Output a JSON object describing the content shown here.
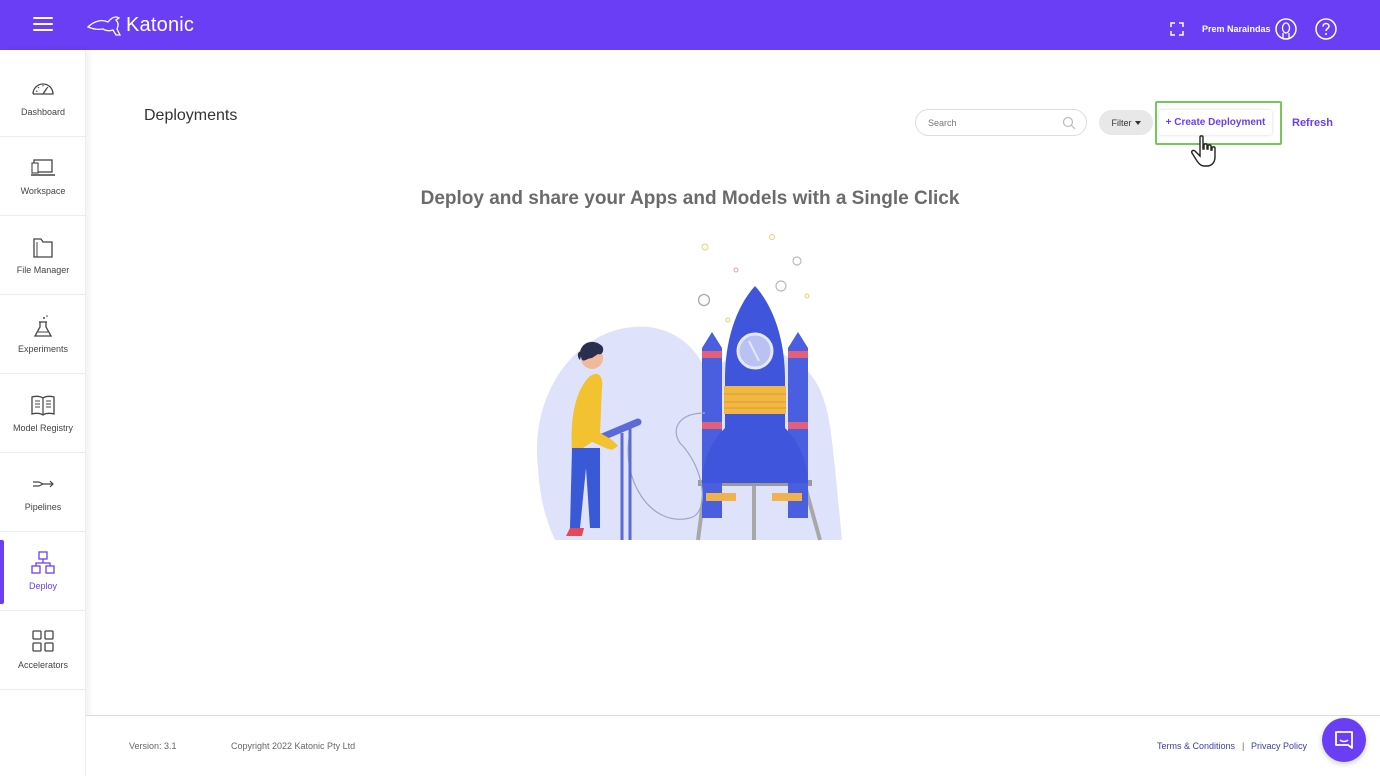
{
  "app": {
    "name": "Katonic"
  },
  "header": {
    "user_name": "Prem Naraindas"
  },
  "sidebar": {
    "items": [
      {
        "label": "Dashboard",
        "icon": "gauge-icon"
      },
      {
        "label": "Workspace",
        "icon": "laptop-icon"
      },
      {
        "label": "File Manager",
        "icon": "folder-icon"
      },
      {
        "label": "Experiments",
        "icon": "flask-icon"
      },
      {
        "label": "Model Registry",
        "icon": "book-icon"
      },
      {
        "label": "Pipelines",
        "icon": "pipeline-icon"
      },
      {
        "label": "Deploy",
        "icon": "deploy-icon",
        "active": true
      },
      {
        "label": "Accelerators",
        "icon": "grid-icon"
      }
    ]
  },
  "main": {
    "title": "Deployments",
    "search_placeholder": "Search",
    "filter_label": "Filter",
    "create_label": "+ Create Deployment",
    "refresh_label": "Refresh",
    "hero_text": "Deploy and share your Apps and Models with a Single Click"
  },
  "footer": {
    "version": "Version: 3.1",
    "copyright": "Copyright 2022 Katonic Pty Ltd",
    "terms": "Terms & Conditions",
    "separator": "|",
    "privacy": "Privacy Policy"
  },
  "colors": {
    "brand": "#6a3ef5",
    "highlight": "#76c85a"
  }
}
